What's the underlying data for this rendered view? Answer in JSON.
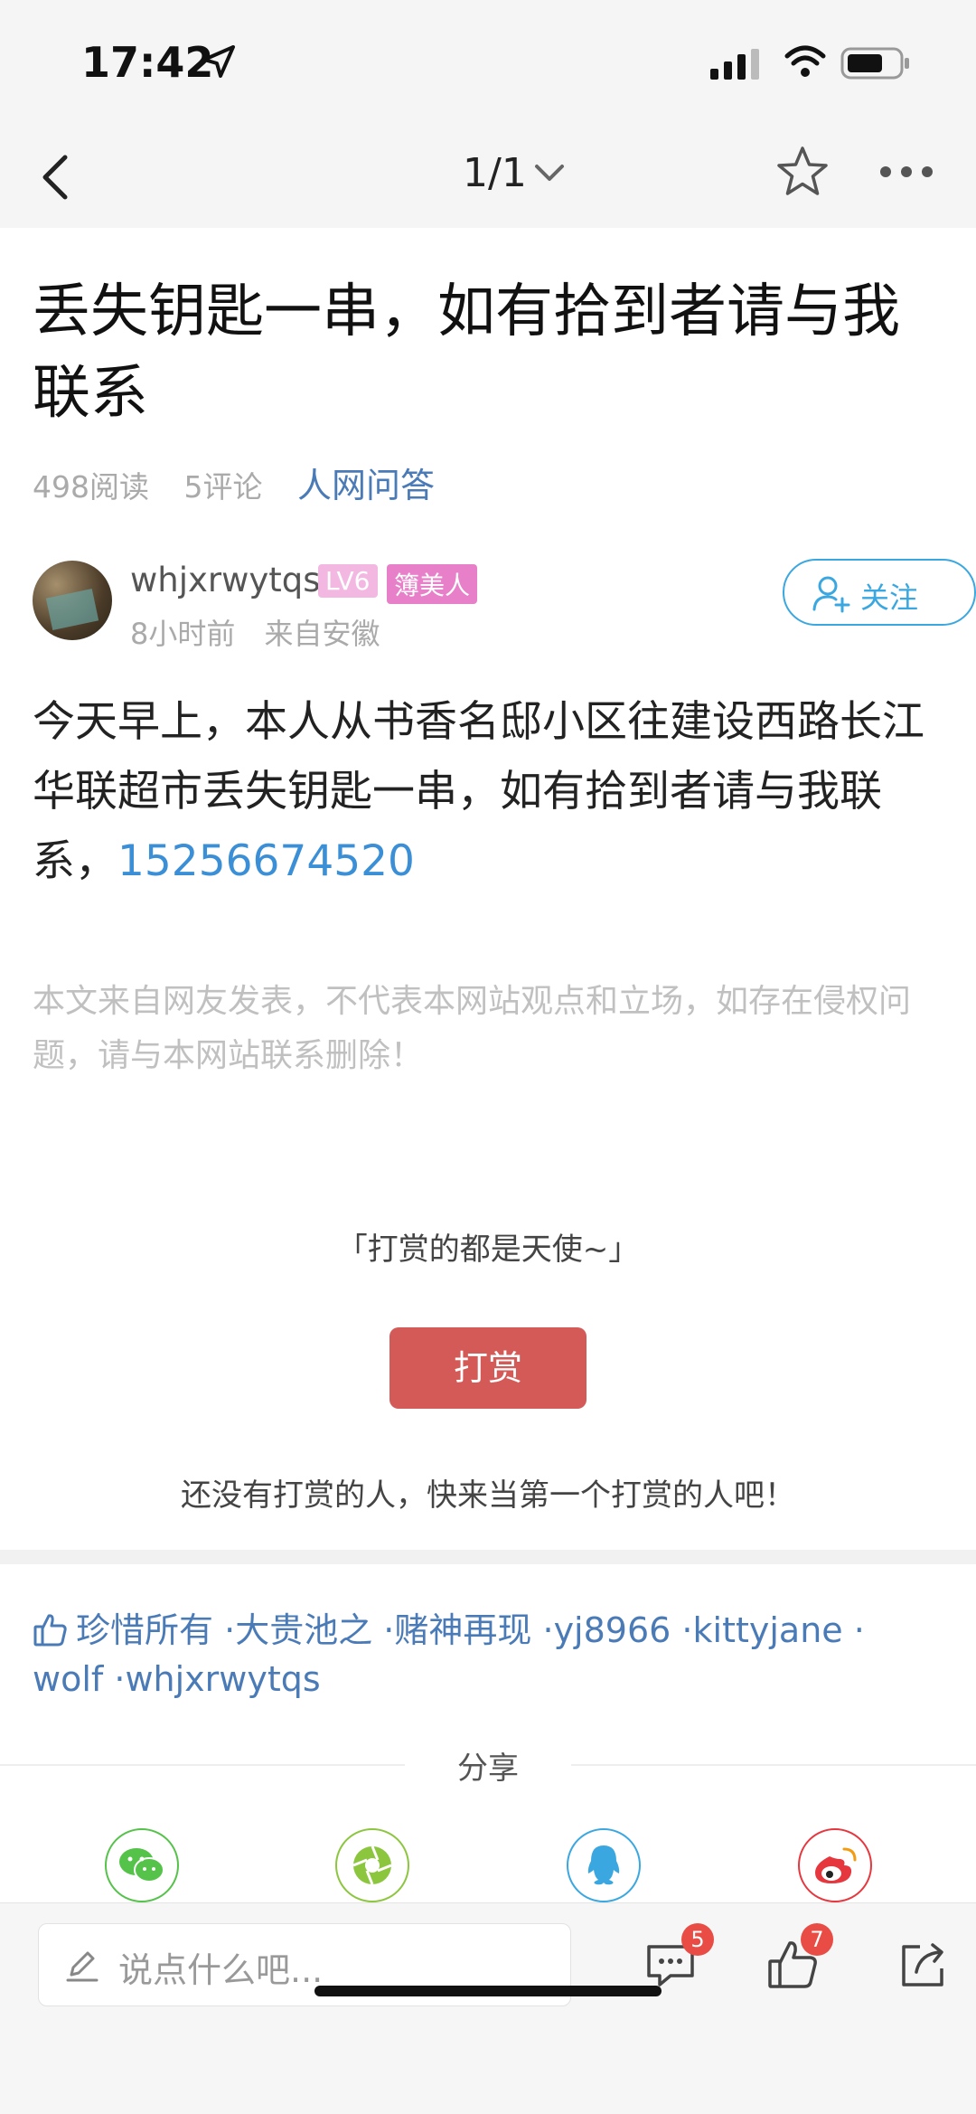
{
  "status_bar": {
    "time": "17:42"
  },
  "nav": {
    "page_indicator": "1/1"
  },
  "article": {
    "title": "丢失钥匙一串，如有拾到者请与我联系",
    "reads": "498阅读",
    "comments": "5评论",
    "category": "人网问答",
    "author": {
      "name": "whjxrwytqs",
      "level": "LV6",
      "badge": "簿美人",
      "time": "8小时前",
      "from": "来自安徽"
    },
    "follow_label": "关注",
    "body_text": "今天早上，本人从书香名邸小区往建设西路长江华联超市丢失钥匙一串，如有拾到者请与我联系，",
    "phone": "15256674520",
    "disclaimer": "本文来自网友发表，不代表本网站观点和立场，如存在侵权问题，请与本网站联系删除！"
  },
  "reward": {
    "quote": "「打赏的都是天使~」",
    "button": "打赏",
    "note": "还没有打赏的人，快来当第一个打赏的人吧！"
  },
  "likes": {
    "names": [
      "珍惜所有",
      "·大贵池之",
      "·赌神再现",
      "·yj8966",
      "·kittyjane",
      "·",
      "wolf",
      "·whjxrwytqs"
    ]
  },
  "share": {
    "label": "分享",
    "targets": [
      "wechat-icon",
      "moments-icon",
      "qq-icon",
      "weibo-icon"
    ]
  },
  "bottom_bar": {
    "comment_placeholder": "说点什么吧...",
    "comment_count": "5",
    "like_count": "7"
  },
  "colors": {
    "accent_blue": "#3aa7e0",
    "link_blue": "#4a7bb7",
    "reward_red": "#d45a57",
    "badge_red": "#e94b45"
  }
}
